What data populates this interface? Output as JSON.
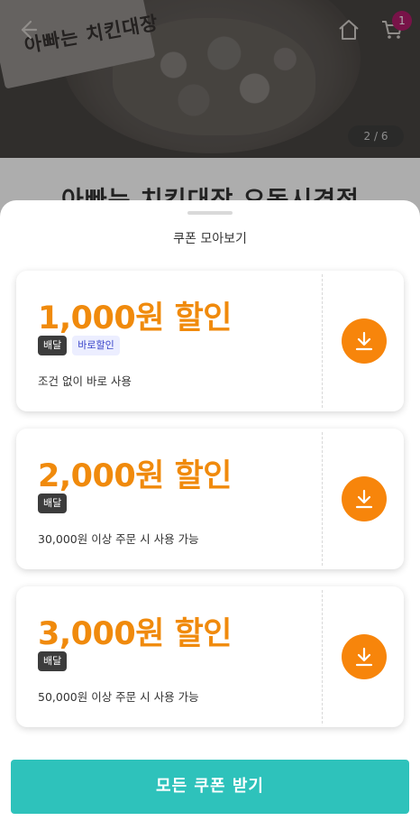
{
  "hero": {
    "sign_text": "아빠는 치킨대장",
    "page_indicator": "2 / 6",
    "cart_count": "1",
    "product_title": "아빠는 치킨대장 오동시경점"
  },
  "icons": {
    "back": "back-arrow-icon",
    "home": "home-icon",
    "cart": "cart-icon",
    "download": "download-icon"
  },
  "sheet": {
    "title": "쿠폰 모아보기",
    "coupons": [
      {
        "amount": "1,000원 할인",
        "tags": [
          "배달",
          "바로할인"
        ],
        "condition": "조건 없이 바로 사용"
      },
      {
        "amount": "2,000원 할인",
        "tags": [
          "배달"
        ],
        "condition": "30,000원 이상 주문 시 사용 가능"
      },
      {
        "amount": "3,000원 할인",
        "tags": [
          "배달"
        ],
        "condition": "50,000원 이상 주문 시 사용 가능"
      }
    ],
    "cta_label": "모든 쿠폰 받기"
  },
  "colors": {
    "accent_orange": "#f7850b",
    "amount_orange": "#f08a0c",
    "cta_teal": "#2ec2bb",
    "tag_dark": "#3c3c3c",
    "tag_light_bg": "#eceeff",
    "tag_light_text": "#3a45c9",
    "badge": "#b21c6b"
  }
}
